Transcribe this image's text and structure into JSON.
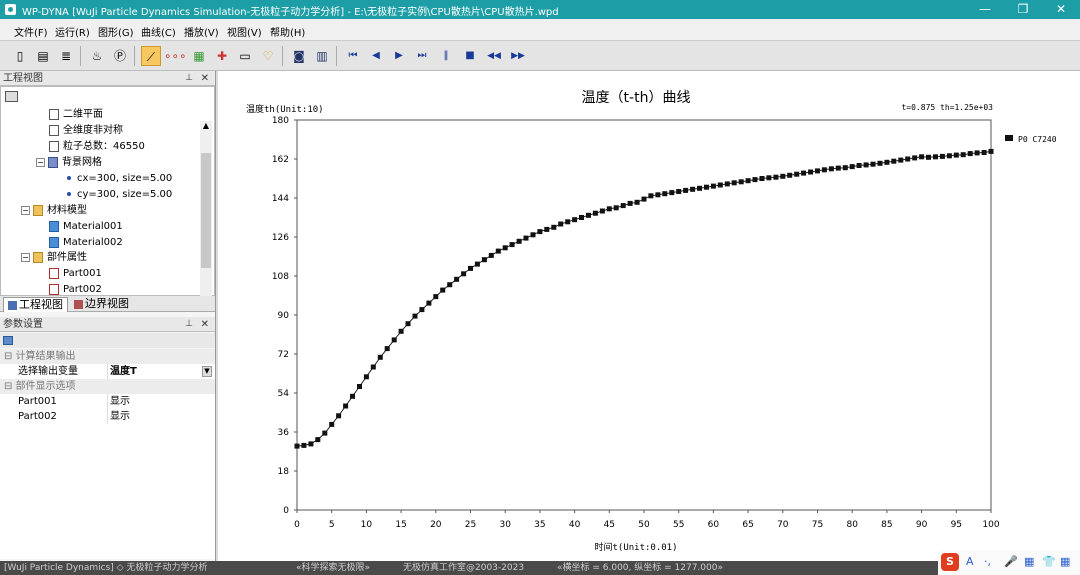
{
  "window": {
    "title": "WP-DYNA [WuJi Particle Dynamics Simulation-无极粒子动力学分析] - E:\\无极粒子实例\\CPU散热片\\CPU散热片.wpd",
    "controls": {
      "minimize": "—",
      "restore": "❐",
      "close": "✕"
    }
  },
  "menu": [
    "文件(F)",
    "运行(R)",
    "图形(G)",
    "曲线(C)",
    "播放(V)",
    "视图(V)",
    "帮助(H)"
  ],
  "toolbar": {
    "items": [
      "new-file-icon",
      "open-folder-icon",
      "note-icon",
      "part-icon",
      "p-icon",
      "curve-icon",
      "dots-icon",
      "color-map-icon",
      "axis-icon",
      "monitor-icon",
      "bulb-icon",
      "camera-icon",
      "record-icon",
      "first-frame-icon",
      "prev-icon",
      "play-icon",
      "next-frame-icon",
      "pause-icon",
      "stop-icon",
      "rewind-icon",
      "fast-forward-icon"
    ],
    "glyphs": [
      "▯",
      "▤",
      "≣",
      "♨",
      "Ⓟ",
      "⟋",
      "∘∘∘",
      "▦",
      "✚",
      "▭",
      "♡",
      "◙",
      "▥",
      "⏮",
      "◀",
      "▶",
      "⏭",
      "‖",
      "■",
      "◀◀",
      "▶▶"
    ],
    "active_index": 5
  },
  "project_panel": {
    "title": "工程视图",
    "tree": [
      {
        "label": "二维平面",
        "icon": "doc",
        "level": 2
      },
      {
        "label": "全维度非对称",
        "icon": "doc",
        "level": 2
      },
      {
        "label": "粒子总数：46550",
        "icon": "doc",
        "level": 2
      },
      {
        "label": "背景网格",
        "icon": "grid",
        "level": 2,
        "expander": "−"
      },
      {
        "label": "cx=300, size=5.00",
        "icon": "dot",
        "level": 3
      },
      {
        "label": "cy=300, size=5.00",
        "icon": "dot",
        "level": 3
      },
      {
        "label": "材料模型",
        "icon": "folder",
        "level": 1,
        "expander": "−"
      },
      {
        "label": "Material001",
        "icon": "mat",
        "level": 2
      },
      {
        "label": "Material002",
        "icon": "mat",
        "level": 2
      },
      {
        "label": "部件属性",
        "icon": "folder",
        "level": 1,
        "expander": "−"
      },
      {
        "label": "Part001",
        "icon": "part",
        "level": 2
      },
      {
        "label": "Part002",
        "icon": "part",
        "level": 2
      }
    ],
    "tabs": [
      "工程视图",
      "边界视图"
    ]
  },
  "param_panel": {
    "title": "参数设置",
    "rows": [
      {
        "type": "cat",
        "label": "计算结果输出"
      },
      {
        "type": "row",
        "key": "选择输出变量",
        "value": "温度T",
        "dropdown": true
      },
      {
        "type": "cat",
        "label": "部件显示选项"
      },
      {
        "type": "row",
        "key": "Part001",
        "value": "显示"
      },
      {
        "type": "row",
        "key": "Part002",
        "value": "显示"
      }
    ]
  },
  "chart_data": {
    "type": "line",
    "title": "温度（t-th）曲线",
    "ylabel": "温度th(Unit:10)",
    "xlabel": "时间t(Unit:0.01)",
    "readout": "t=0.875  th=1.25e+03",
    "legend": {
      "label": "P0 C7240",
      "placement": "right"
    },
    "xlim": [
      0,
      100
    ],
    "ylim": [
      0,
      180
    ],
    "xticks": [
      0,
      5,
      10,
      15,
      20,
      25,
      30,
      35,
      40,
      45,
      50,
      55,
      60,
      65,
      70,
      75,
      80,
      85,
      90,
      95,
      100
    ],
    "yticks": [
      0,
      18,
      36,
      54,
      72,
      90,
      108,
      126,
      144,
      162,
      180
    ],
    "series": [
      {
        "name": "P0 C7240",
        "x": [
          0,
          1,
          2,
          3,
          4,
          5,
          6,
          7,
          8,
          9,
          10,
          11,
          12,
          13,
          14,
          15,
          16,
          17,
          18,
          19,
          20,
          21,
          22,
          23,
          24,
          25,
          26,
          27,
          28,
          29,
          30,
          31,
          32,
          33,
          34,
          35,
          36,
          37,
          38,
          39,
          40,
          41,
          42,
          43,
          44,
          45,
          46,
          47,
          48,
          49,
          50,
          51,
          52,
          53,
          54,
          55,
          56,
          57,
          58,
          59,
          60,
          61,
          62,
          63,
          64,
          65,
          66,
          67,
          68,
          69,
          70,
          71,
          72,
          73,
          74,
          75,
          76,
          77,
          78,
          79,
          80,
          81,
          82,
          83,
          84,
          85,
          86,
          87,
          88,
          89,
          90,
          91,
          92,
          93,
          94,
          95,
          96,
          97,
          98,
          99,
          100
        ],
        "y": [
          29.5,
          29.8,
          30.5,
          32.5,
          35.5,
          39.5,
          43.5,
          48,
          52.5,
          57,
          61.5,
          66,
          70.5,
          74.5,
          78.5,
          82.5,
          86,
          89.5,
          92.5,
          95.5,
          98.5,
          101.5,
          104,
          106.5,
          109,
          111.5,
          113.5,
          115.5,
          117.5,
          119.5,
          121,
          122.5,
          124,
          125.5,
          127,
          128.5,
          129.5,
          130.5,
          132,
          133,
          134,
          135,
          136,
          137,
          138,
          139,
          139.5,
          140.5,
          141.5,
          142,
          143.5,
          145,
          145.5,
          146,
          146.5,
          147,
          147.5,
          148,
          148.5,
          149,
          149.5,
          150,
          150.5,
          151,
          151.5,
          152,
          152.5,
          153,
          153.3,
          153.6,
          154,
          154.5,
          155,
          155.5,
          156,
          156.5,
          157,
          157.5,
          157.8,
          158,
          158.5,
          159,
          159.3,
          159.6,
          160,
          160.5,
          161,
          161.5,
          162,
          162.5,
          163,
          162.8,
          163,
          163.2,
          163.5,
          163.8,
          164,
          164.5,
          164.8,
          165,
          165.5
        ]
      }
    ]
  },
  "statusbar": {
    "app": "[WuJi Particle Dynamics] ◇ 无极粒子动力学分析",
    "slogan": "«科学探索无极限»",
    "studio": "无极仿真工作室@2003-2023",
    "coords": "«横坐标 = 6.000, 纵坐标 = 1277.000»"
  },
  "ime": {
    "logo": "S",
    "items": [
      "A",
      "·,",
      "🎤",
      "▦",
      "👕",
      "▦"
    ]
  }
}
